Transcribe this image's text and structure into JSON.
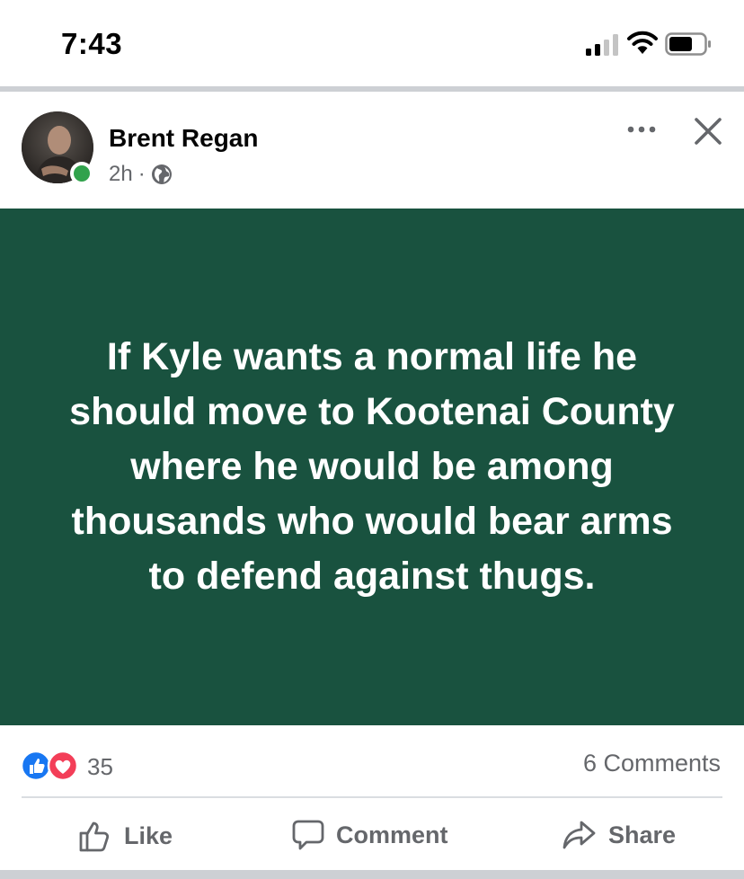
{
  "status_bar": {
    "time": "7:43",
    "icons": [
      "cellular-signal-icon",
      "wifi-icon",
      "battery-icon"
    ]
  },
  "post": {
    "author": "Brent Regan",
    "timestamp": "2h",
    "separator": "·",
    "privacy_icon": "globe-icon",
    "online": true,
    "header_icons": [
      "more-options-icon",
      "close-icon"
    ],
    "body_text": "If Kyle wants a normal life he should move to Kootenai County where he would be among thousands who would bear arms to defend against thugs.",
    "background_color": "#19523f",
    "reactions": {
      "types": [
        "like",
        "love"
      ],
      "count": "35"
    },
    "comments_label": "6 Comments",
    "actions": {
      "like": "Like",
      "comment": "Comment",
      "share": "Share"
    }
  }
}
